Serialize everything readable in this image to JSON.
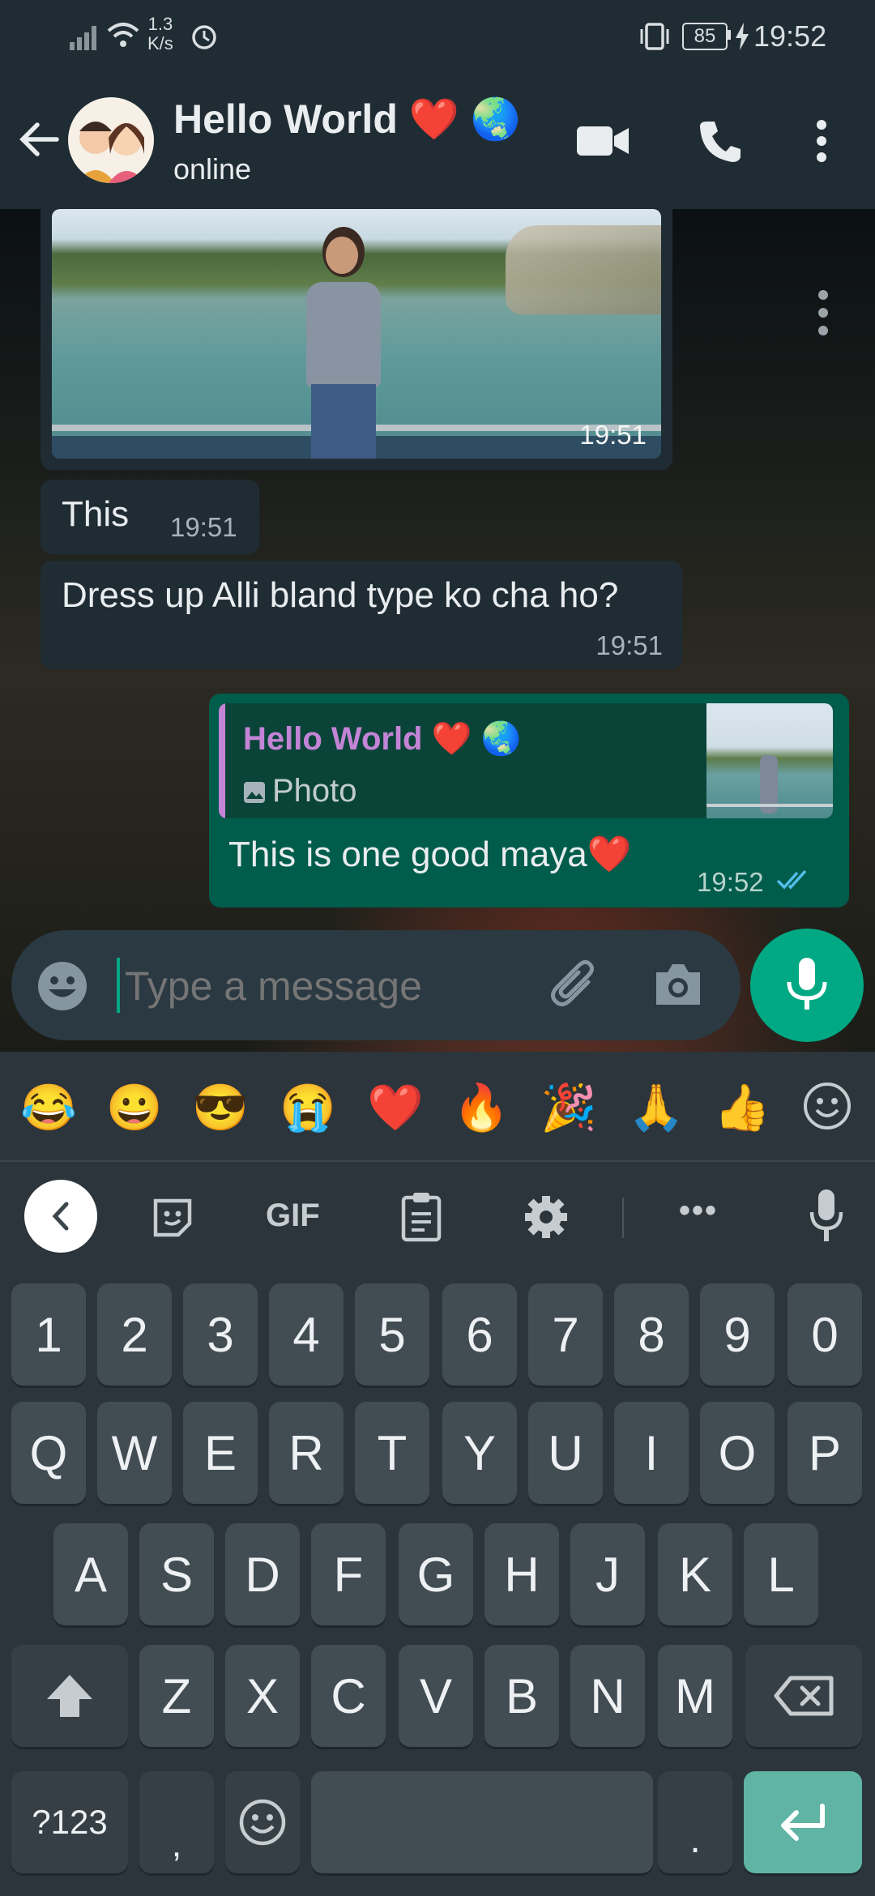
{
  "status_bar": {
    "net_speed_value": "1.3",
    "net_speed_unit": "K/s",
    "battery": "85",
    "time": "19:52"
  },
  "header": {
    "contact_name": "Hello World ❤️ 🌏",
    "status": "online"
  },
  "messages": [
    {
      "type": "image",
      "direction": "in",
      "time": "19:51"
    },
    {
      "type": "text",
      "direction": "in",
      "text": "This",
      "time": "19:51"
    },
    {
      "type": "text",
      "direction": "in",
      "text": "Dress up Alli bland type ko cha ho?",
      "time": "19:51"
    },
    {
      "type": "reply",
      "direction": "out",
      "quoted_name": "Hello World ❤️ 🌏",
      "quoted_type": "Photo",
      "text": "This is one good maya❤️",
      "time": "19:52",
      "status": "read"
    }
  ],
  "compose": {
    "placeholder": "Type a message"
  },
  "emoji_bar": [
    "😂",
    "😀",
    "😎",
    "😭",
    "❤️",
    "🔥",
    "🎉",
    "🙏",
    "👍"
  ],
  "keyboard_toolbar": {
    "gif_label": "GIF",
    "more_label": "•••"
  },
  "keyboard": {
    "row_numbers": [
      "1",
      "2",
      "3",
      "4",
      "5",
      "6",
      "7",
      "8",
      "9",
      "0"
    ],
    "row1": [
      "Q",
      "W",
      "E",
      "R",
      "T",
      "Y",
      "U",
      "I",
      "O",
      "P"
    ],
    "row2": [
      "A",
      "S",
      "D",
      "F",
      "G",
      "H",
      "J",
      "K",
      "L"
    ],
    "row3": [
      "Z",
      "X",
      "C",
      "V",
      "B",
      "N",
      "M"
    ],
    "symbols_key": "?123",
    "comma_key": ",",
    "period_key": "."
  },
  "colors": {
    "header_bg": "#1f2c33",
    "incoming_bubble": "#1f2c33",
    "outgoing_bubble": "#005c4b",
    "accent": "#00a884",
    "read_tick": "#53bdeb",
    "quote_name": "#c484d6"
  }
}
